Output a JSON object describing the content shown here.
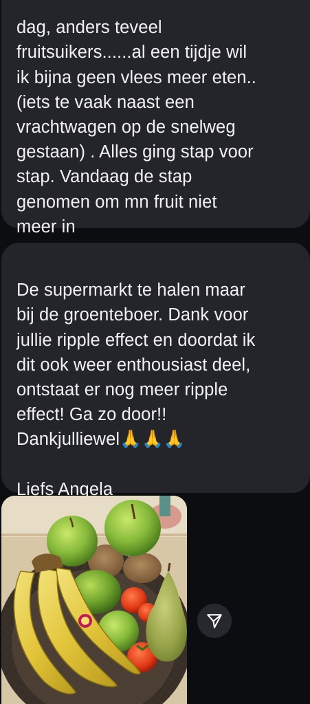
{
  "messages": [
    {
      "text": "dag, anders teveel\nfruitsuikers......al een tijdje wil\nik bijna geen vlees meer eten..\n(iets te vaak naast een\nvrachtwagen op de snelweg\ngestaan) . Alles ging stap voor\nstap. Vandaag de stap\ngenomen om mn fruit niet\nmeer in"
    },
    {
      "text": "De supermarkt te halen maar\nbij de groenteboer. Dank voor\njullie ripple effect en doordat ik\ndit ook weer enthousiast deel,\nontstaat er nog meer ripple\neffect! Ga zo door!!\nDankjulliewel🙏🙏🙏\n\nLiefs Angela"
    }
  ],
  "attachment": {
    "icon": "fruit-bowl-photo"
  },
  "share_button": {
    "icon": "share-icon"
  }
}
